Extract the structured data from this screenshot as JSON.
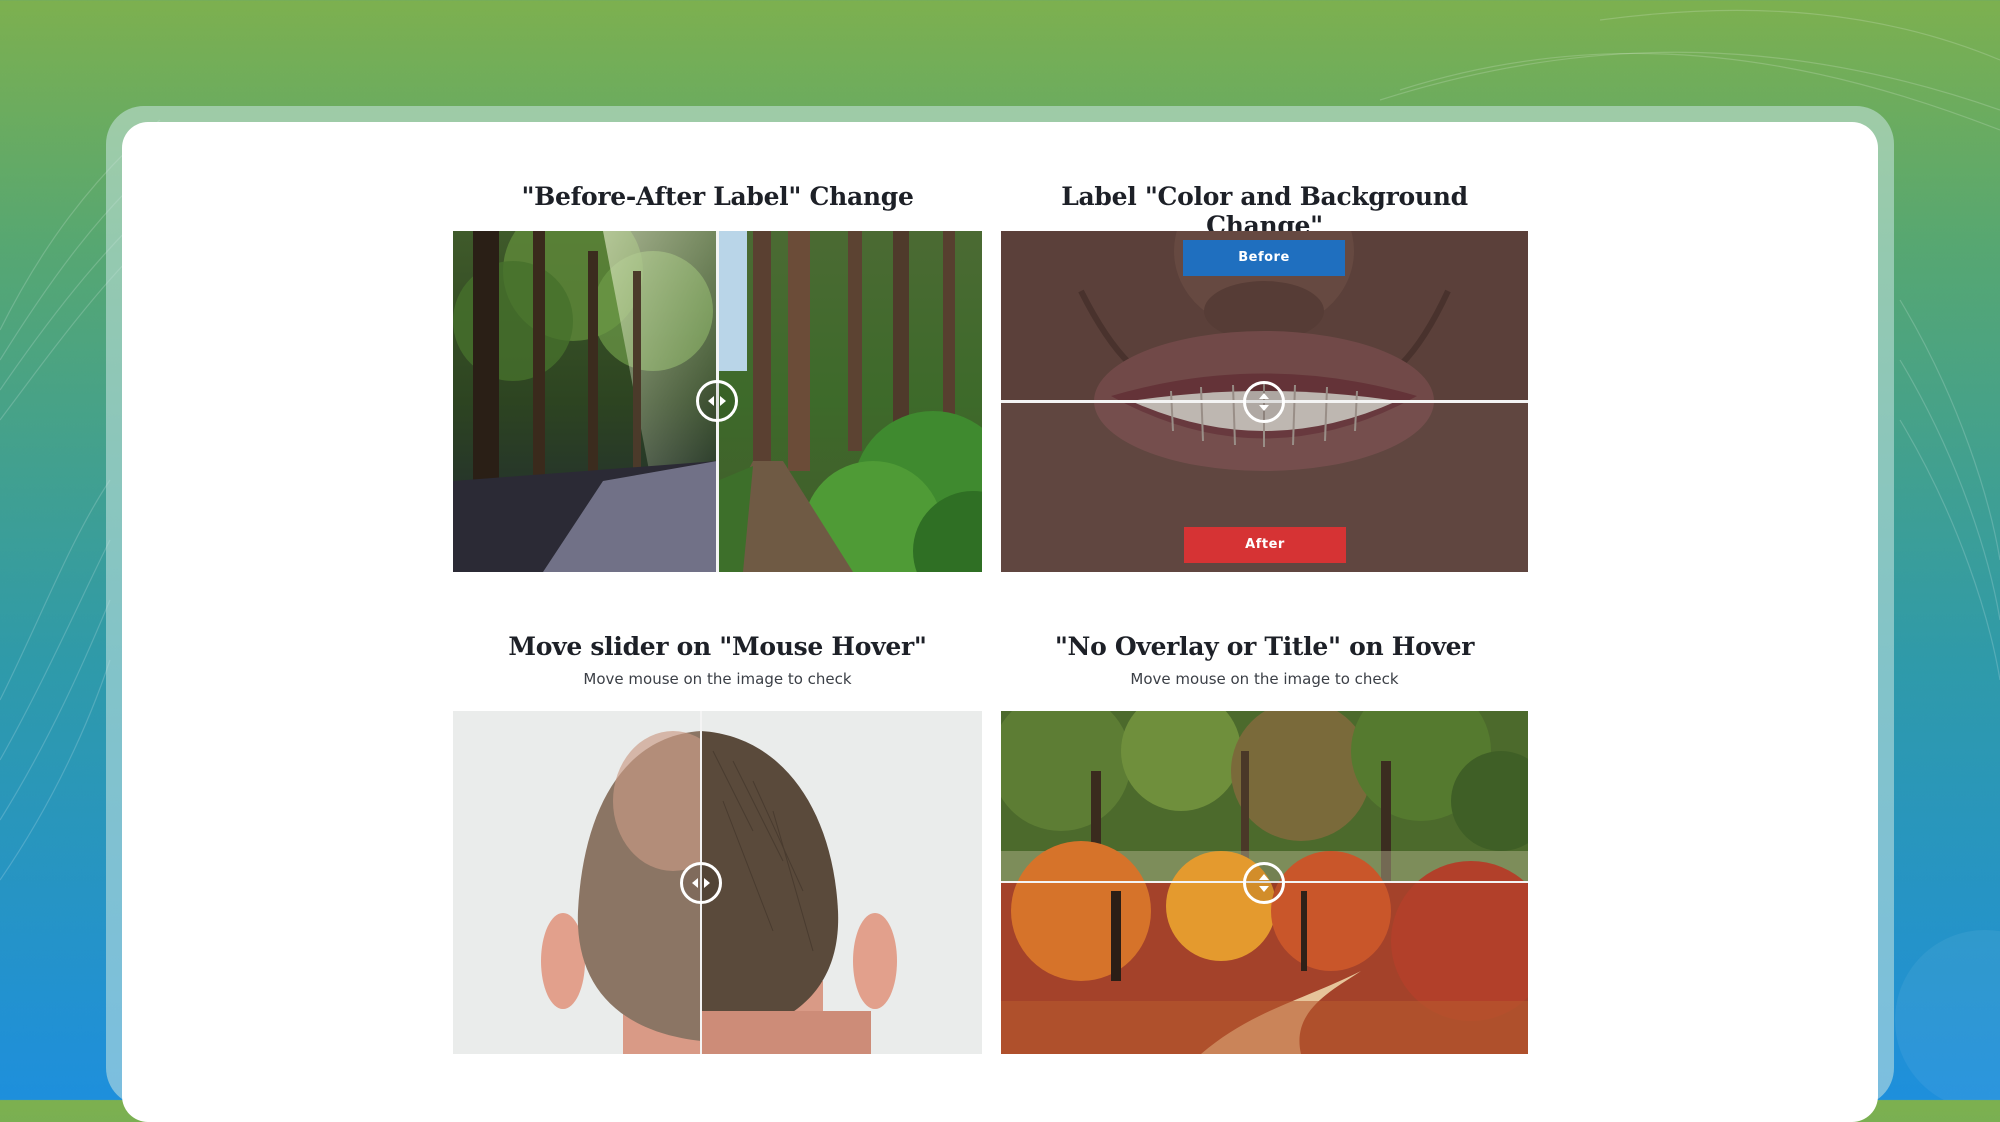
{
  "colors": {
    "before_label_bg": "#1f6fbf",
    "after_label_bg": "#d63334",
    "handle": "#ffffff"
  },
  "demos": [
    {
      "title": "\"Before-After Label\" Change",
      "subtitle": "",
      "orientation": "horizontal",
      "slider_position": 0.5,
      "images": [
        "forest-path-sunlight",
        "forest-path-green"
      ]
    },
    {
      "title": "Label \"Color and Background Change\"",
      "subtitle": "",
      "orientation": "vertical",
      "slider_position": 0.5,
      "before_label": "Before",
      "after_label": "After",
      "images": [
        "smile-before",
        "smile-after"
      ]
    },
    {
      "title": "Move slider on \"Mouse Hover\"",
      "subtitle": "Move mouse on the image to check",
      "orientation": "horizontal",
      "slider_position": 0.47,
      "images": [
        "hair-thinning-before",
        "hair-restored-after"
      ]
    },
    {
      "title": "\"No Overlay or Title\" on Hover",
      "subtitle": "Move mouse on the image to check",
      "orientation": "vertical",
      "slider_position": 0.5,
      "images": [
        "summer-forest",
        "autumn-forest-path"
      ]
    }
  ]
}
